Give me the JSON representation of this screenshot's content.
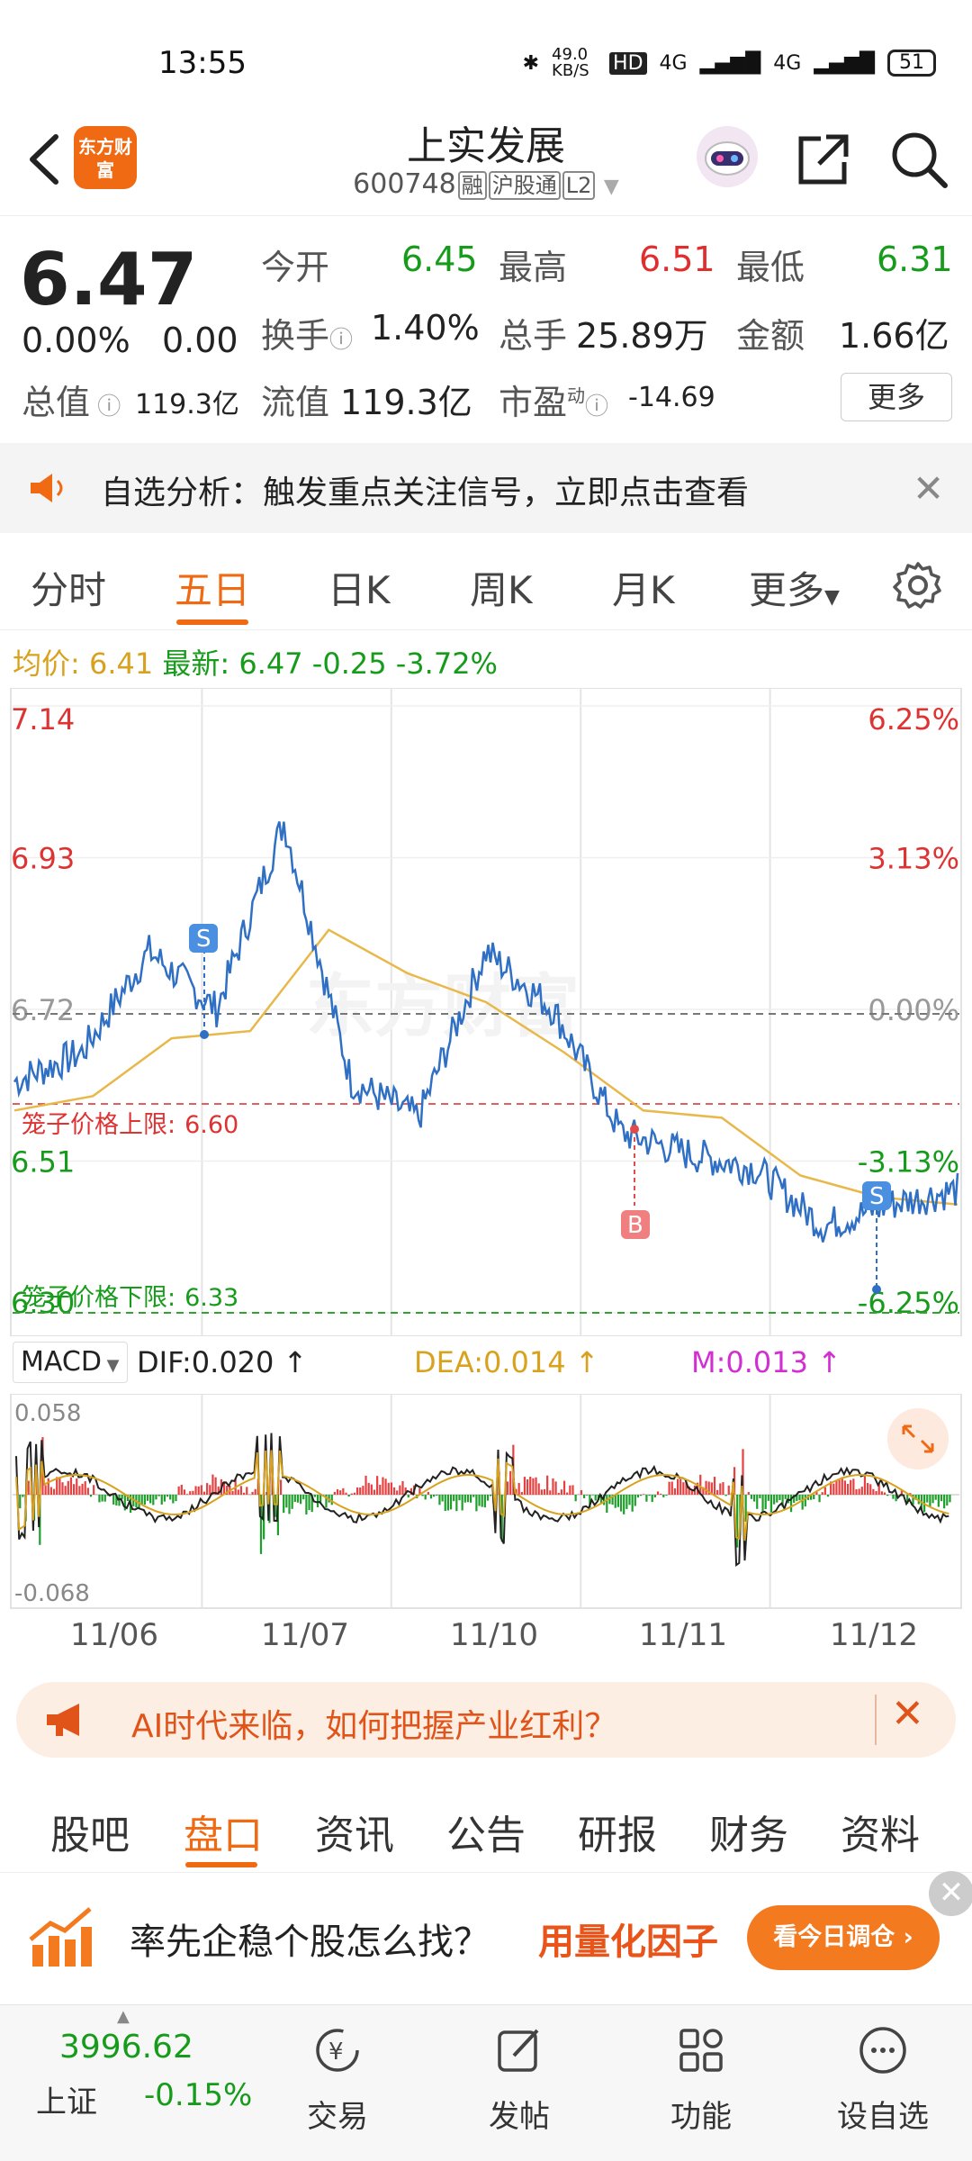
{
  "status_bar": {
    "time": "13:55",
    "net_speed": "49.0 KB/S",
    "hd": "HD",
    "sig1": "4G",
    "sig2": "4G",
    "battery": "51"
  },
  "header": {
    "title": "上实发展",
    "code": "600748",
    "tags": [
      "融",
      "沪股通",
      "L2"
    ],
    "logo": "东方财富"
  },
  "quote": {
    "price": "6.47",
    "change_pct": "0.00%",
    "change_abs": "0.00",
    "open_label": "今开",
    "open": "6.45",
    "high_label": "最高",
    "high": "6.51",
    "low_label": "最低",
    "low": "6.31",
    "turnover_label": "换手",
    "turnover": "1.40%",
    "volume_label": "总手",
    "volume": "25.89万",
    "amount_label": "金额",
    "amount": "1.66亿",
    "mcap_label": "总值",
    "mcap": "119.3亿",
    "float_label": "流值",
    "float": "119.3亿",
    "pe_label": "市盈",
    "pe_super": "动",
    "pe": "-14.69",
    "more": "更多"
  },
  "notice": {
    "text": "自选分析：触发重点关注信号，立即点击查看"
  },
  "period_tabs": [
    "分时",
    "五日",
    "日K",
    "周K",
    "月K",
    "更多"
  ],
  "summary": {
    "avg_label": "均价:",
    "avg": "6.41",
    "latest_label": "最新:",
    "latest": "6.47",
    "chg": "-0.25",
    "chg_pct": "-3.72%"
  },
  "chart_data": {
    "type": "line",
    "x": [
      "11/06",
      "11/07",
      "11/10",
      "11/11",
      "11/12"
    ],
    "series": [
      {
        "name": "价格",
        "values": [
          6.62,
          6.66,
          6.8,
          6.72,
          6.98,
          6.62,
          6.57,
          6.8,
          6.72,
          6.55,
          6.52,
          6.5,
          6.42,
          6.45,
          6.47
        ]
      },
      {
        "name": "均价",
        "values": [
          6.58,
          6.6,
          6.68,
          6.69,
          6.83,
          6.77,
          6.73,
          6.66,
          6.58,
          6.57,
          6.49,
          6.46,
          6.45
        ]
      }
    ],
    "y_left_ticks": [
      "7.14",
      "6.93",
      "6.72",
      "6.51",
      "6.30"
    ],
    "y_right_ticks": [
      "6.25%",
      "3.13%",
      "0.00%",
      "-3.13%",
      "-6.25%"
    ],
    "ylim": [
      6.3,
      7.14
    ],
    "upper_limit_label": "笼子价格上限:",
    "upper_limit": "6.60",
    "lower_limit_label": "笼子价格下限:",
    "lower_limit": "6.33",
    "markers": [
      "S",
      "B",
      "S"
    ],
    "watermark": "东方财富"
  },
  "macd": {
    "selector": "MACD",
    "dif": "DIF:0.020",
    "dea": "DEA:0.014",
    "m": "M:0.013",
    "top": "0.058",
    "bottom": "-0.068"
  },
  "ai_banner": {
    "text": "AI时代来临，如何把握产业红利？"
  },
  "info_tabs": [
    "股吧",
    "盘口",
    "资讯",
    "公告",
    "研报",
    "财务",
    "资料"
  ],
  "promo": {
    "text": "率先企稳个股怎么找？",
    "highlight": "用量化因子",
    "button": "看今日调仓"
  },
  "bottom_nav": {
    "index_value": "3996.62",
    "index_name": "上证",
    "index_chg": "-0.15%",
    "items": [
      "交易",
      "发帖",
      "功能",
      "设自选"
    ]
  }
}
